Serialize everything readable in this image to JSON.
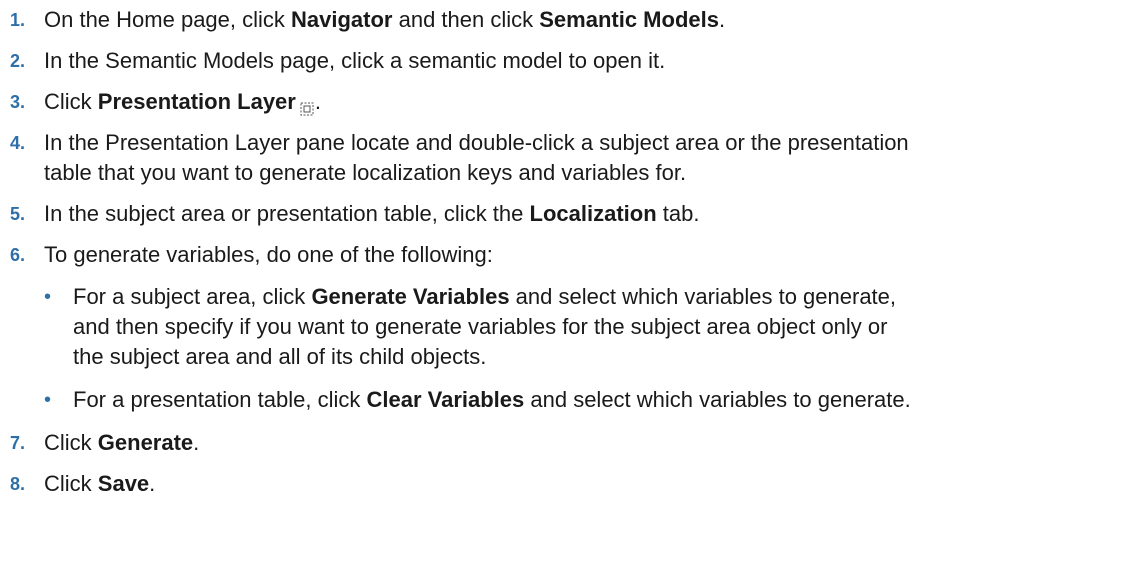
{
  "steps": [
    {
      "num": "1.",
      "parts": [
        "On the Home page, click ",
        "Navigator",
        " and then click ",
        "Semantic Models",
        "."
      ]
    },
    {
      "num": "2.",
      "text": "In the Semantic Models page, click a semantic model to open it."
    },
    {
      "num": "3.",
      "parts": [
        "Click ",
        "Presentation Layer",
        "."
      ],
      "icon": "presentation-layer-icon"
    },
    {
      "num": "4.",
      "line1": "In the Presentation Layer pane locate and double-click a subject area or the presentation",
      "line2": "table that you want to generate localization keys and variables for."
    },
    {
      "num": "5.",
      "parts": [
        "In the subject area or presentation table, click the ",
        "Localization",
        " tab."
      ]
    },
    {
      "num": "6.",
      "text": "To generate variables, do one of the following:",
      "bullets": [
        {
          "dot": "•",
          "line1_parts": [
            "For a subject area, click ",
            "Generate Variables",
            " and select which variables to generate,"
          ],
          "line2": "and then specify if you want to generate variables for the subject area object only or",
          "line3": "the subject area and all of its child objects."
        },
        {
          "dot": "•",
          "parts": [
            "For a presentation table, click ",
            "Clear Variables",
            " and select which variables to generate."
          ]
        }
      ]
    },
    {
      "num": "7.",
      "parts": [
        "Click ",
        "Generate",
        "."
      ]
    },
    {
      "num": "8.",
      "parts": [
        "Click ",
        "Save",
        "."
      ]
    }
  ]
}
